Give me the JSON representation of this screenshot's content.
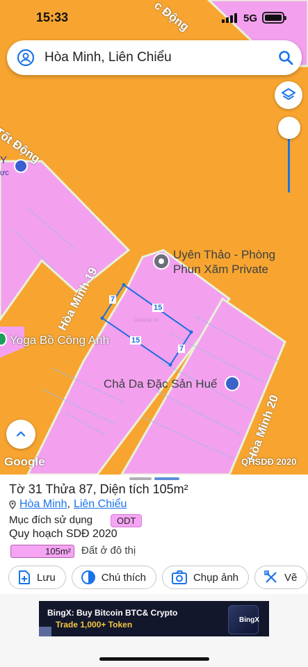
{
  "status_bar": {
    "time": "15:33",
    "network": "5G"
  },
  "search": {
    "query": "Hòa Minh, Liên Chiểu"
  },
  "map": {
    "street_labels": [
      "Tốt Động",
      "c Động",
      "Hòa Minh 19",
      "Hòa Minh 20"
    ],
    "pois": [
      "Uyên Thảo - Phòng",
      "Phun Xăm Private",
      "Yoga Bồ Công Anh",
      "Chả Da Đặc Sản Huế"
    ],
    "parcel_dims": [
      "15",
      "7",
      "15",
      "7"
    ],
    "partial_labels": [
      "Y",
      "ực"
    ],
    "watermark": "Guland.vn",
    "google_logo": "Google",
    "badge": "QHSDĐ 2020",
    "colors": {
      "background": "#f7a530",
      "land": "#f3a1ef",
      "road": "#f7a530"
    }
  },
  "info": {
    "title": "Tờ 31 Thửa 87, Diện tích 105m²",
    "ward": "Hòa Minh",
    "district": "Liên Chiểu",
    "separator": ",",
    "purpose_label": "Mục đích sử dụng",
    "purpose_code": "ODT",
    "plan_label": "Quy hoạch SDĐ 2020",
    "area_value": "105m²",
    "land_use": "Đất ở đô thị"
  },
  "actions": [
    {
      "label": "Lưu",
      "icon": "add-document-icon"
    },
    {
      "label": "Chú thích",
      "icon": "contrast-icon"
    },
    {
      "label": "Chụp ảnh",
      "icon": "camera-icon"
    },
    {
      "label": "Vẽ",
      "icon": "draw-tools-icon"
    }
  ],
  "ad": {
    "line1": "BingX: Buy Bitcoin BTC& Crypto",
    "line2": "Trade 1,000+ Token",
    "brand": "BingX"
  }
}
